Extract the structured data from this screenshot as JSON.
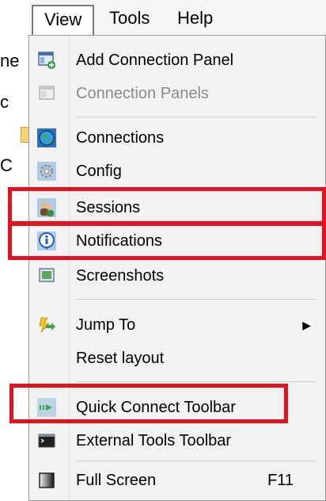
{
  "menubar": {
    "items": [
      {
        "label": "View"
      },
      {
        "label": "Tools"
      },
      {
        "label": "Help"
      }
    ]
  },
  "background_fragments": [
    "ne",
    "c",
    "C"
  ],
  "view_menu": {
    "items": [
      {
        "label": "Add Connection Panel",
        "icon": "add-panel-icon",
        "enabled": true
      },
      {
        "label": "Connection Panels",
        "icon": "panels-icon",
        "enabled": false
      },
      {
        "label": "Connections",
        "icon": "globe-icon",
        "enabled": true
      },
      {
        "label": "Config",
        "icon": "gear-icon",
        "enabled": true
      },
      {
        "label": "Sessions",
        "icon": "users-icon",
        "enabled": true
      },
      {
        "label": "Notifications",
        "icon": "info-icon",
        "enabled": true
      },
      {
        "label": "Screenshots",
        "icon": "screenshot-icon",
        "enabled": true
      },
      {
        "label": "Jump To",
        "icon": "jump-icon",
        "enabled": true,
        "submenu": true
      },
      {
        "label": "Reset layout",
        "enabled": true
      },
      {
        "label": "Quick Connect Toolbar",
        "icon": "quick-connect-icon",
        "enabled": true
      },
      {
        "label": "External Tools Toolbar",
        "icon": "terminal-icon",
        "enabled": true
      },
      {
        "label": "Full Screen",
        "icon": "fullscreen-icon",
        "enabled": true,
        "shortcut": "F11"
      }
    ]
  },
  "highlight_color": "#e0131e"
}
